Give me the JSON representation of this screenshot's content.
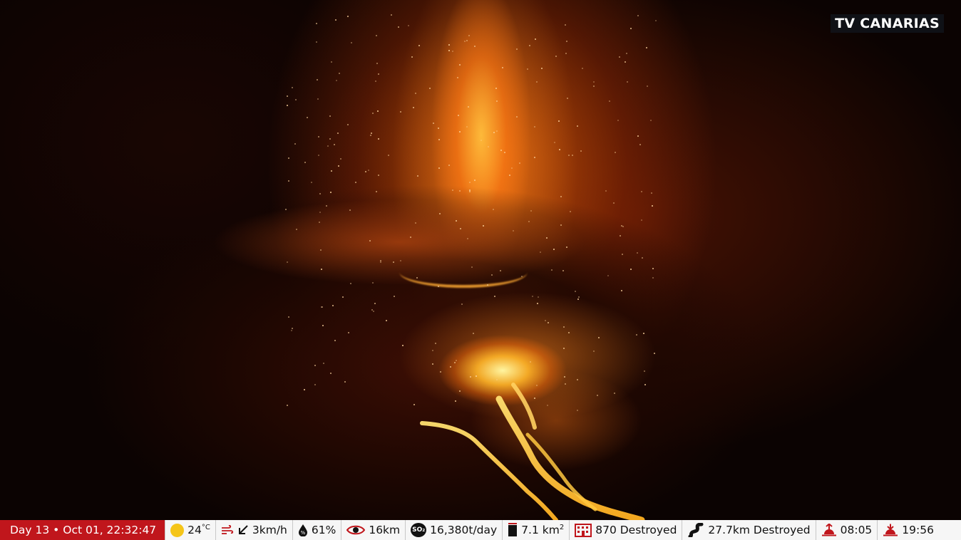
{
  "overlay": {
    "channel_logo": "TV CANARIAS"
  },
  "ticker": {
    "date_time": "Day 13 • Oct 01, 22:32:47",
    "temperature": "24",
    "temperature_unit": "°C",
    "wind": "3km/h",
    "humidity": "61%",
    "visibility": "16km",
    "so2": "16,380t/day",
    "area_value": "7.1 km",
    "area_exponent": "2",
    "buildings": "870 Destroyed",
    "roads": "27.7km Destroyed",
    "sunrise": "08:05",
    "sunset": "19:56"
  },
  "icons": {
    "weather": "sun-icon",
    "wind": "wind-icon",
    "wind_direction": "arrow-down-left-icon",
    "humidity": "humidity-drop-icon",
    "visibility": "eye-icon",
    "so2": "so2-icon",
    "area": "area-icon",
    "buildings": "building-icon",
    "roads": "road-icon",
    "sunrise": "sunrise-icon",
    "sunset": "sunset-icon"
  },
  "colors": {
    "ticker_accent": "#c0161c",
    "ticker_background": "#f6f6f6",
    "sun": "#f5c518",
    "wind": "#c0161c"
  }
}
